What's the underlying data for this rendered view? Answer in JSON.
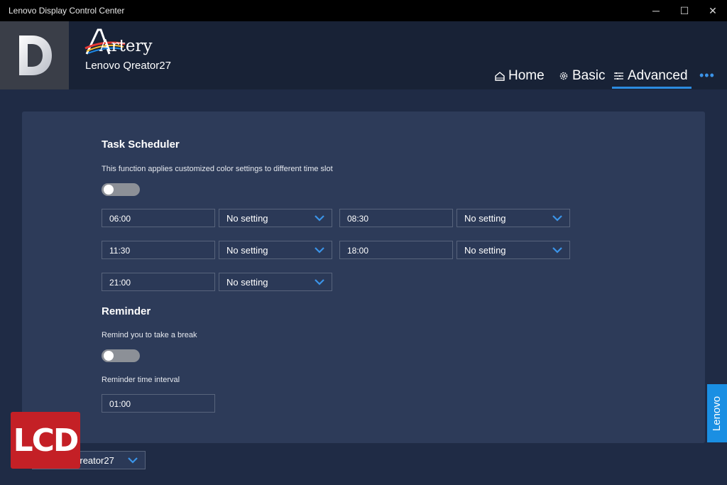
{
  "window": {
    "title": "Lenovo Display Control Center",
    "controls": {
      "minimize": "─",
      "maximize": "☐",
      "close": "✕"
    }
  },
  "header": {
    "logo_letter": "D",
    "brand": "Artery",
    "model": "Lenovo Qreator27",
    "nav": {
      "home": {
        "label": "Home",
        "icon": "home-icon"
      },
      "basic": {
        "label": "Basic",
        "icon": "gear-icon"
      },
      "advanced": {
        "label": "Advanced",
        "icon": "sliders-icon",
        "active": true
      }
    },
    "more": "•••"
  },
  "task_scheduler": {
    "title": "Task Scheduler",
    "description": "This function applies customized color settings to different time slot",
    "enabled": false,
    "slots": [
      {
        "time": "06:00",
        "setting": "No setting"
      },
      {
        "time": "08:30",
        "setting": "No setting"
      },
      {
        "time": "11:30",
        "setting": "No setting"
      },
      {
        "time": "18:00",
        "setting": "No setting"
      },
      {
        "time": "21:00",
        "setting": "No setting"
      }
    ]
  },
  "reminder": {
    "title": "Reminder",
    "break_label": "Remind you to take a break",
    "enabled": false,
    "interval_label": "Reminder time interval",
    "interval_value": "01:00"
  },
  "footer": {
    "watermark": "LCD",
    "monitor_select": "Lenovo Qreator27",
    "side_tab": "Lenovo"
  },
  "colors": {
    "accent": "#2b8be0",
    "card": "#2d3b59",
    "background": "#1f2b45",
    "header": "#182236"
  }
}
